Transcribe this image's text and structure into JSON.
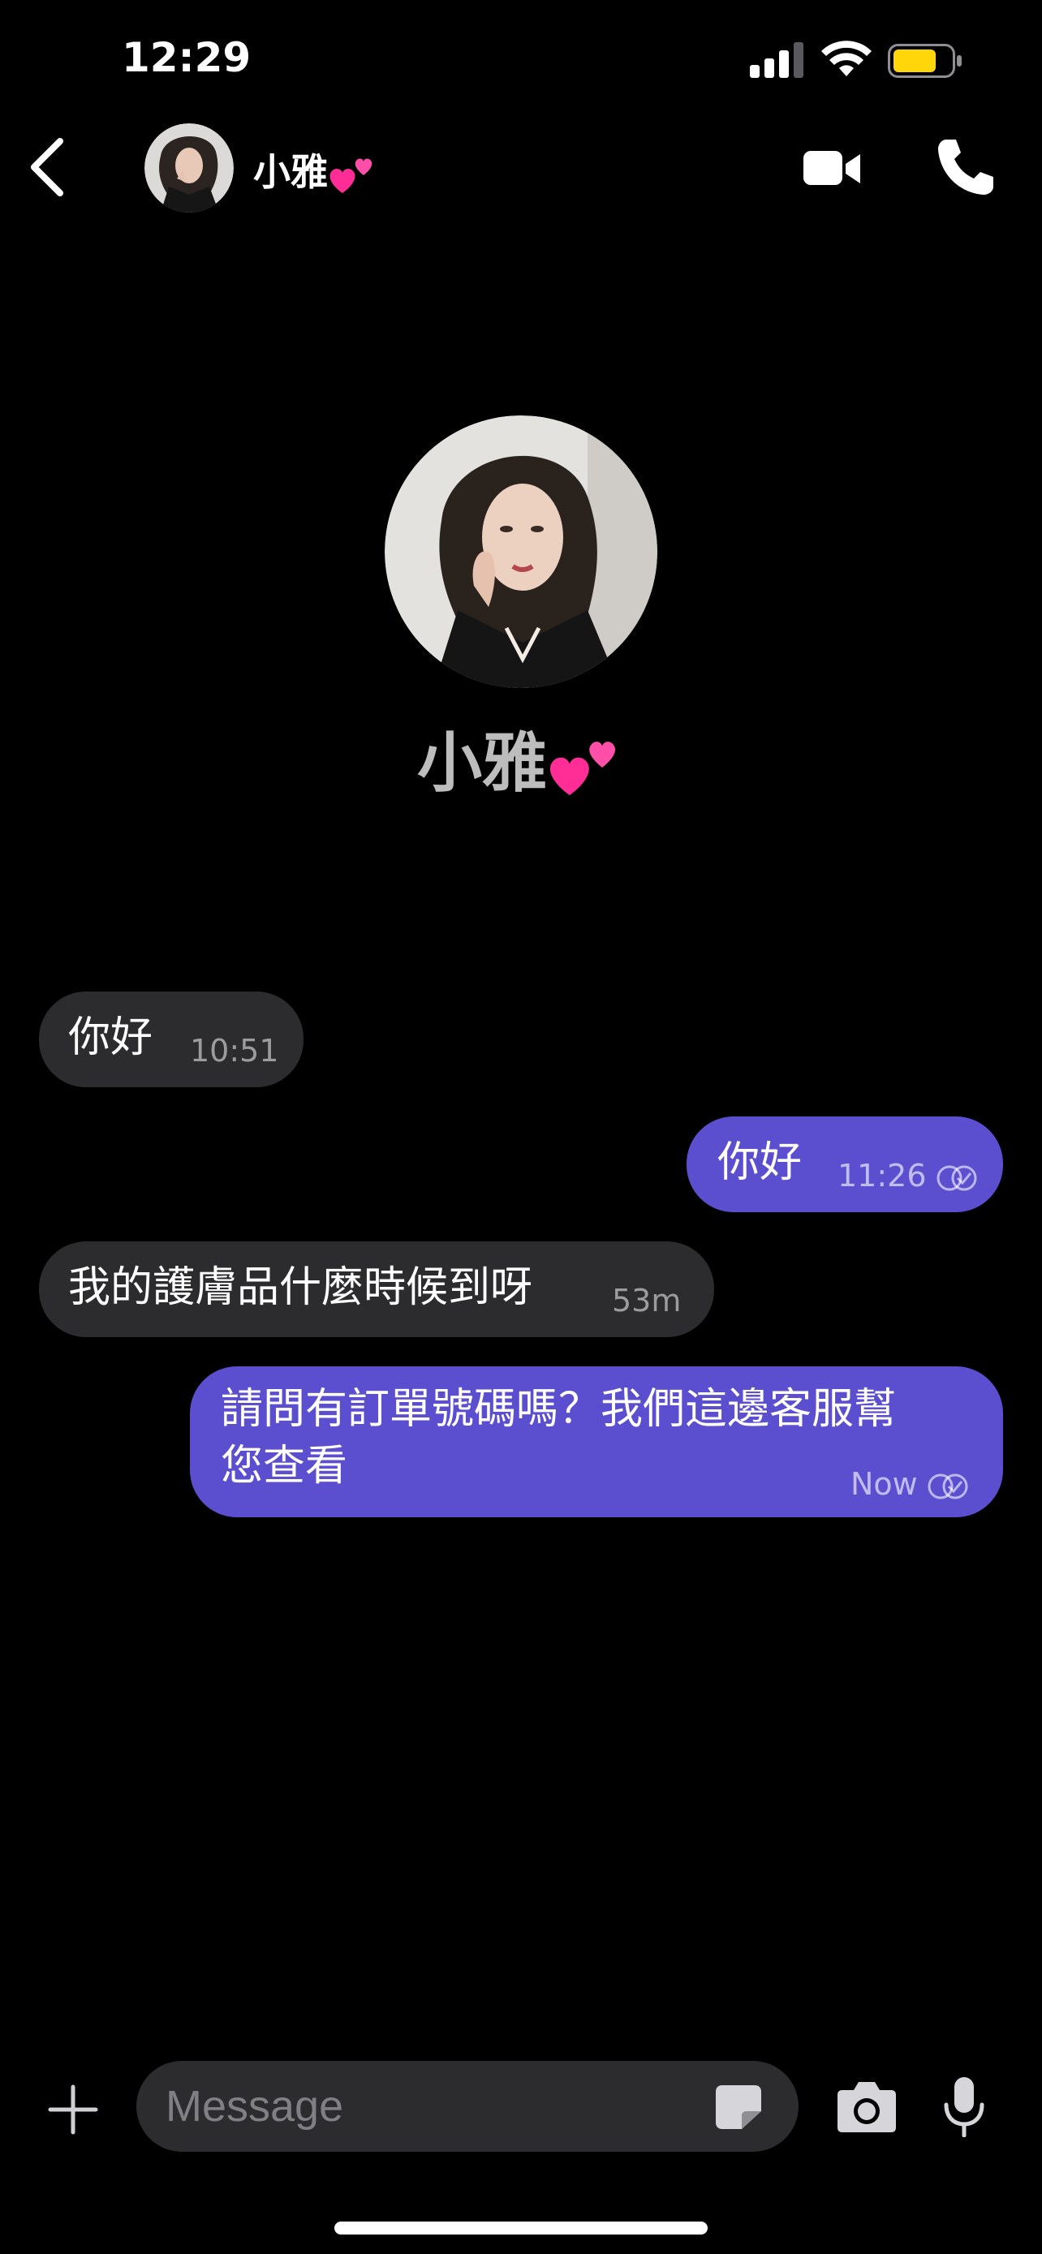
{
  "status_bar": {
    "time": "12:29",
    "battery_color": "#ffd60a"
  },
  "header": {
    "contact_name": "小雅",
    "name_emoji": "two-hearts",
    "icons": [
      "chevron-left-icon",
      "video-camera-icon",
      "phone-icon"
    ]
  },
  "profile": {
    "name": "小雅"
  },
  "messages": [
    {
      "direction": "incoming",
      "text": "你好",
      "time": "10:51"
    },
    {
      "direction": "outgoing",
      "text": "你好",
      "time": "11:26",
      "read_icon": "double-check-icon"
    },
    {
      "direction": "incoming",
      "text": "我的護膚品什麼時候到呀",
      "time": "53m"
    },
    {
      "direction": "outgoing",
      "text_line1": "請問有訂單號碼嗎？我們這邊客服幫",
      "text_line2": "您查看",
      "time": "Now",
      "read_icon": "double-check-icon"
    }
  ],
  "composer": {
    "placeholder": "Message",
    "icons": [
      "plus-icon",
      "sticker-icon",
      "camera-icon",
      "microphone-icon"
    ]
  },
  "colors": {
    "background": "#000000",
    "incoming_bubble": "#2c2c2e",
    "outgoing_bubble": "#5b4fcf",
    "heart": "#ff2d95"
  }
}
